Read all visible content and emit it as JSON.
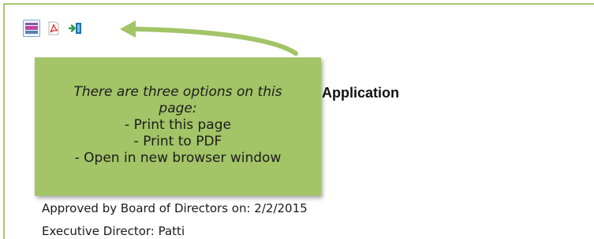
{
  "toolbar": {
    "buttons": [
      {
        "name": "print-page-icon",
        "tooltip": "Print this page"
      },
      {
        "name": "pdf-icon",
        "tooltip": "Print to PDF"
      },
      {
        "name": "open-new-window-icon",
        "tooltip": "Open in new browser window"
      }
    ]
  },
  "document": {
    "heading_visible": "Application",
    "lines": [
      "Approved by Board of Directors on: 2/2/2015",
      "Executive Director: Patti"
    ]
  },
  "callout": {
    "intro_line1": "There are three options on this",
    "intro_line2": "page:",
    "option1": "- Print this page",
    "option2": "- Print to PDF",
    "option3": "- Open in new browser window"
  },
  "colors": {
    "callout_bg": "#a3c467",
    "frame_border": "#a7c86e",
    "arrow": "#a3c467"
  }
}
